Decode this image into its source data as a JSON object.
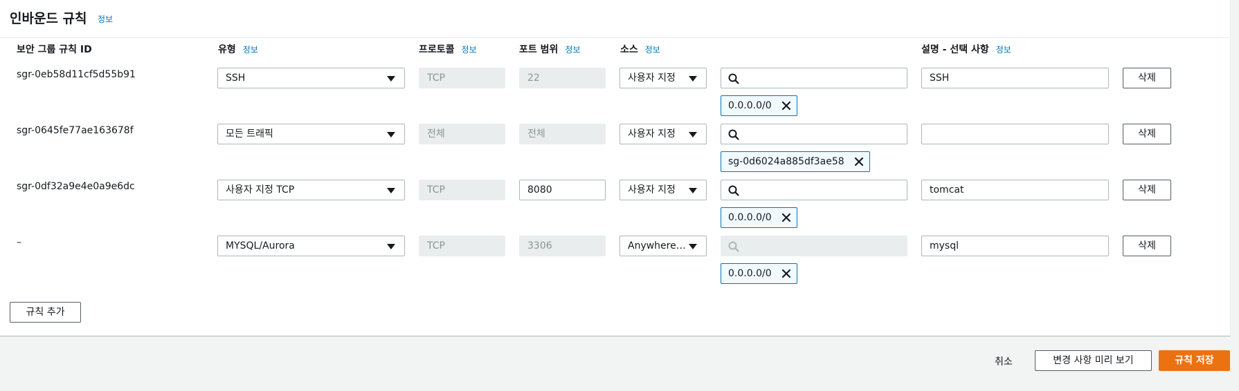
{
  "panel": {
    "title": "인바운드 규칙",
    "info": "정보"
  },
  "columns": {
    "rule_id": "보안 그룹 규칙 ID",
    "type": "유형",
    "protocol": "프로토콜",
    "port_range": "포트 범위",
    "source": "소스",
    "description": "설명 - 선택 사항",
    "info": "정보"
  },
  "rules": [
    {
      "id": "sgr-0eb58d11cf5d55b91",
      "type": "SSH",
      "protocol": "TCP",
      "port": "22",
      "port_editable": false,
      "source": "사용자 지정",
      "search_disabled": false,
      "token": "0.0.0.0/0",
      "description": "SSH",
      "delete": "삭제"
    },
    {
      "id": "sgr-0645fe77ae163678f",
      "type": "모든 트래픽",
      "protocol": "전체",
      "port": "전체",
      "port_editable": false,
      "source": "사용자 지정",
      "search_disabled": false,
      "token": "sg-0d6024a885df3ae58",
      "description": "",
      "delete": "삭제"
    },
    {
      "id": "sgr-0df32a9e4e0a9e6dc",
      "type": "사용자 지정 TCP",
      "protocol": "TCP",
      "port": "8080",
      "port_editable": true,
      "source": "사용자 지정",
      "search_disabled": false,
      "token": "0.0.0.0/0",
      "description": "tomcat",
      "delete": "삭제"
    },
    {
      "id": "–",
      "type": "MYSQL/Aurora",
      "protocol": "TCP",
      "port": "3306",
      "port_editable": false,
      "source": "Anywhere-I...",
      "search_disabled": true,
      "token": "0.0.0.0/0",
      "description": "mysql",
      "delete": "삭제"
    }
  ],
  "add_rule": "규칙 추가",
  "footer": {
    "cancel": "취소",
    "preview": "변경 사항 미리 보기",
    "save": "규칙 저장"
  },
  "colors": {
    "primary": "#ec7211",
    "link": "#0073bb",
    "token_border": "#0073bb"
  }
}
